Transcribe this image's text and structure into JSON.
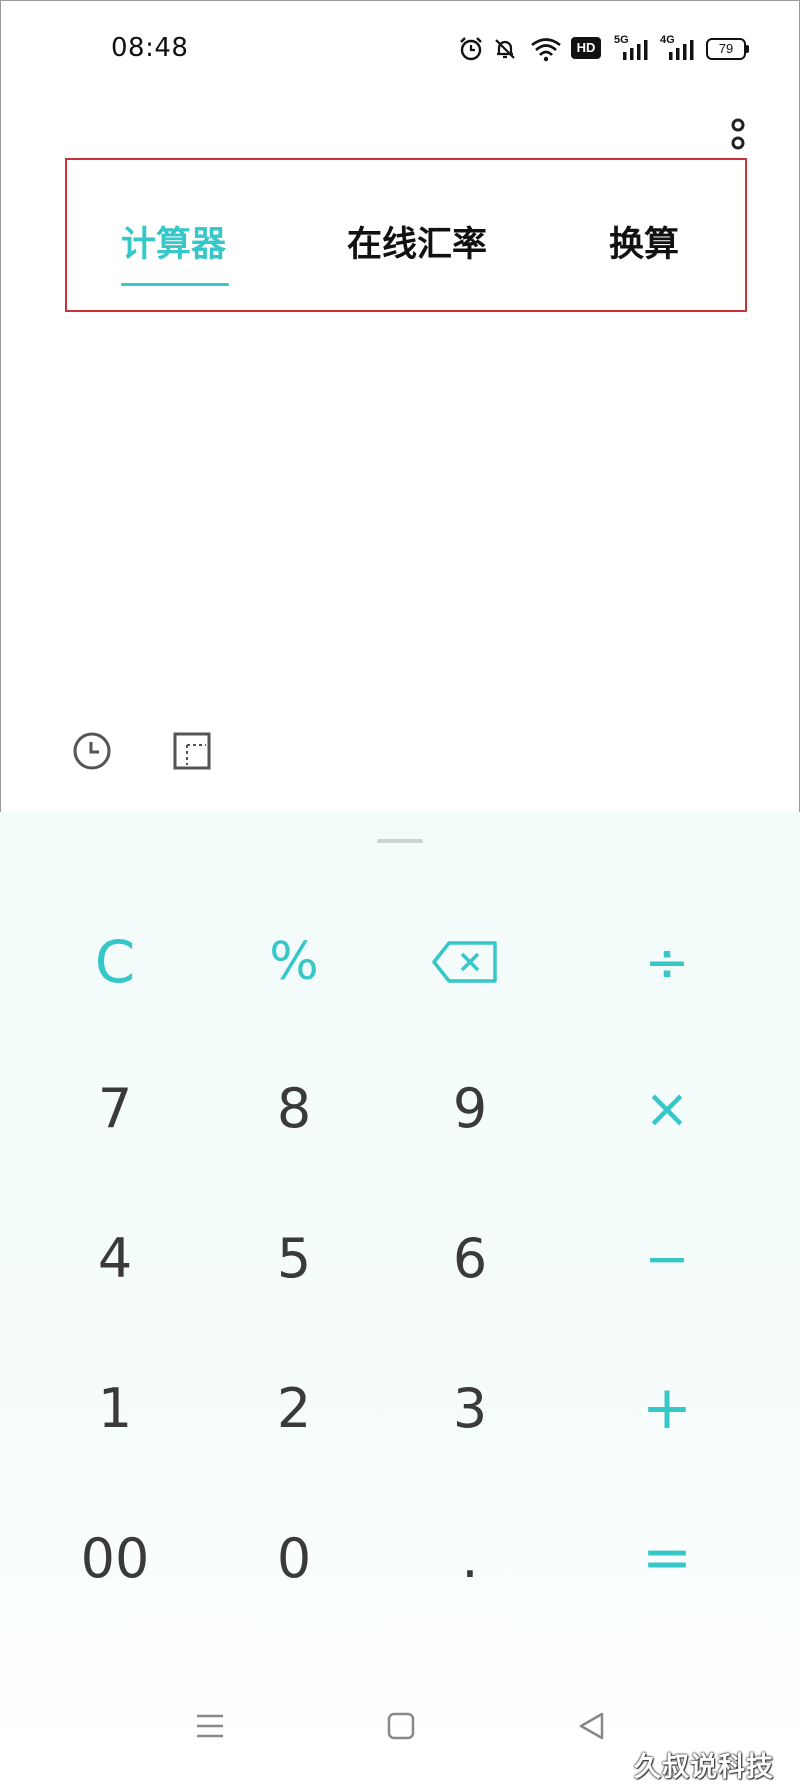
{
  "status_bar": {
    "time": "08:48",
    "hd_badge": "HD",
    "signal_1_label": "5G",
    "signal_2_label": "4G",
    "battery": "79"
  },
  "tabs": [
    {
      "label": "计算器",
      "active": true
    },
    {
      "label": "在线汇率",
      "active": false
    },
    {
      "label": "换算",
      "active": false
    }
  ],
  "keypad": {
    "clear": "C",
    "percent": "%",
    "backspace_icon": "backspace-icon",
    "divide": "÷",
    "multiply": "×",
    "minus": "−",
    "plus": "+",
    "equals": "=",
    "digits": {
      "d7": "7",
      "d8": "8",
      "d9": "9",
      "d4": "4",
      "d5": "5",
      "d6": "6",
      "d1": "1",
      "d2": "2",
      "d3": "3",
      "d00": "00",
      "d0": "0",
      "dot": "."
    }
  },
  "watermark": "久叔说科技",
  "colors": {
    "accent": "#36c7c8",
    "digit_text": "#3a3a3a",
    "keypad_bg": "#f3fbfb",
    "highlight_box": "#c8323a"
  }
}
